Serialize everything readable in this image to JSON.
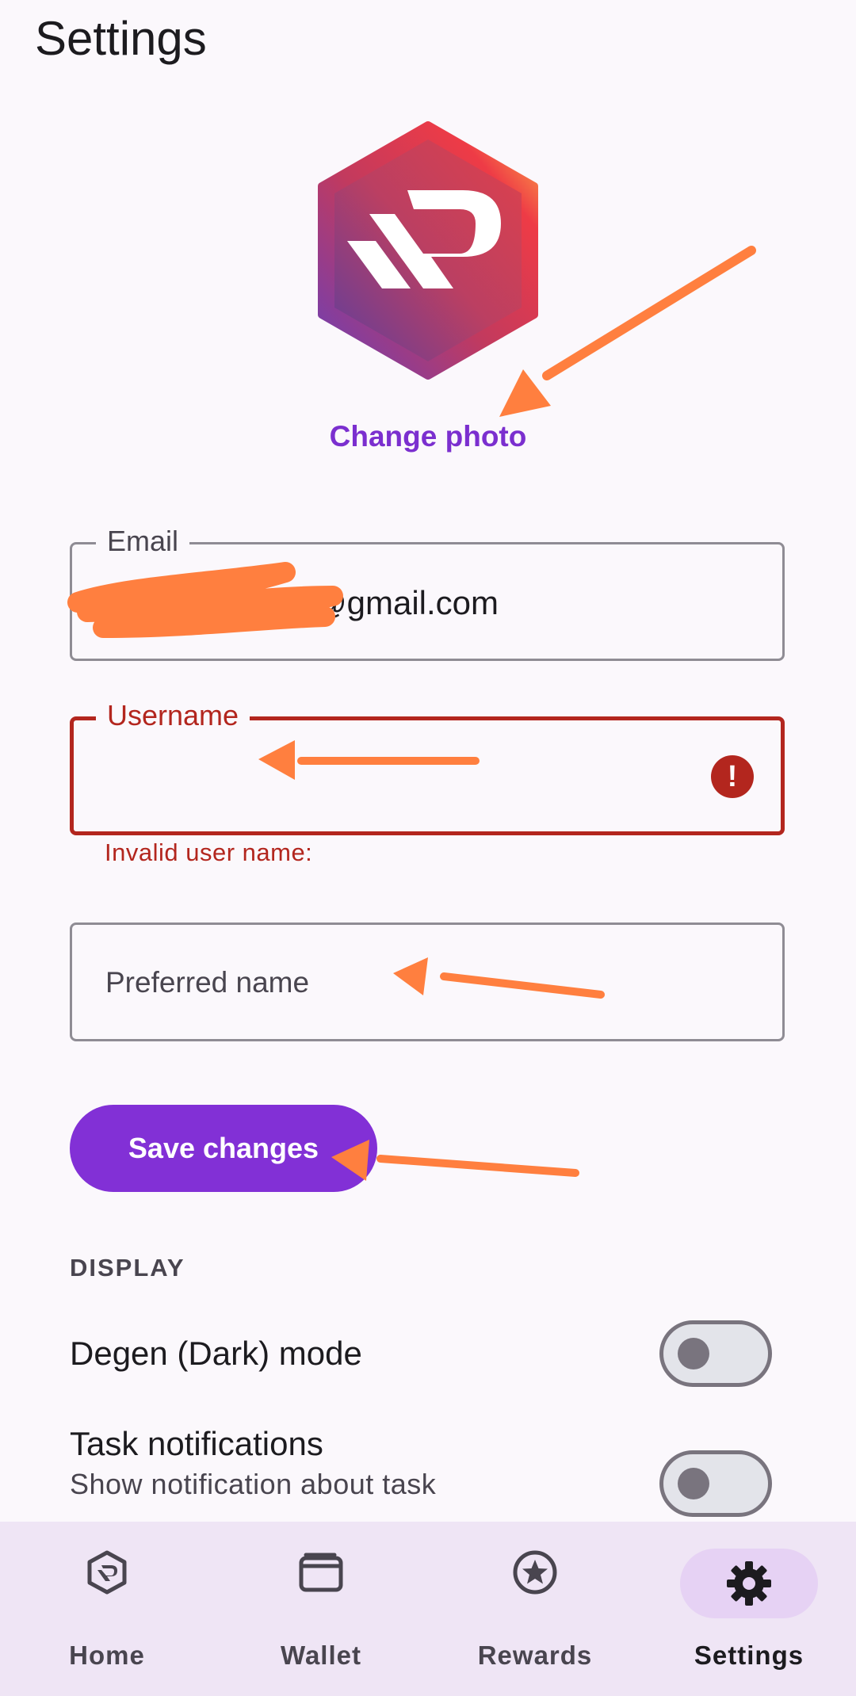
{
  "header": {
    "title": "Settings"
  },
  "profile": {
    "change_photo_label": "Change photo"
  },
  "form": {
    "email": {
      "label": "Email",
      "value": "@gmail.com"
    },
    "username": {
      "label": "Username",
      "value": "",
      "error_icon": "!",
      "error": "Invalid user name:"
    },
    "preferred_name": {
      "placeholder": "Preferred name",
      "value": ""
    },
    "save_label": "Save changes"
  },
  "display": {
    "section_title": "DISPLAY",
    "dark_mode": {
      "label": "Degen (Dark) mode",
      "enabled": false
    },
    "task_notifications": {
      "label": "Task notifications",
      "description": "Show notification about task",
      "enabled": false
    }
  },
  "bottom_nav": {
    "items": [
      {
        "label": "Home",
        "icon": "logo-hexagon-icon"
      },
      {
        "label": "Wallet",
        "icon": "wallet-icon"
      },
      {
        "label": "Rewards",
        "icon": "star-badge-icon"
      },
      {
        "label": "Settings",
        "icon": "gear-icon",
        "active": true
      }
    ]
  },
  "colors": {
    "accent": "#8230d6",
    "error": "#b3261e",
    "annotation": "#ff7f3f",
    "nav_background": "#efe5f5"
  }
}
